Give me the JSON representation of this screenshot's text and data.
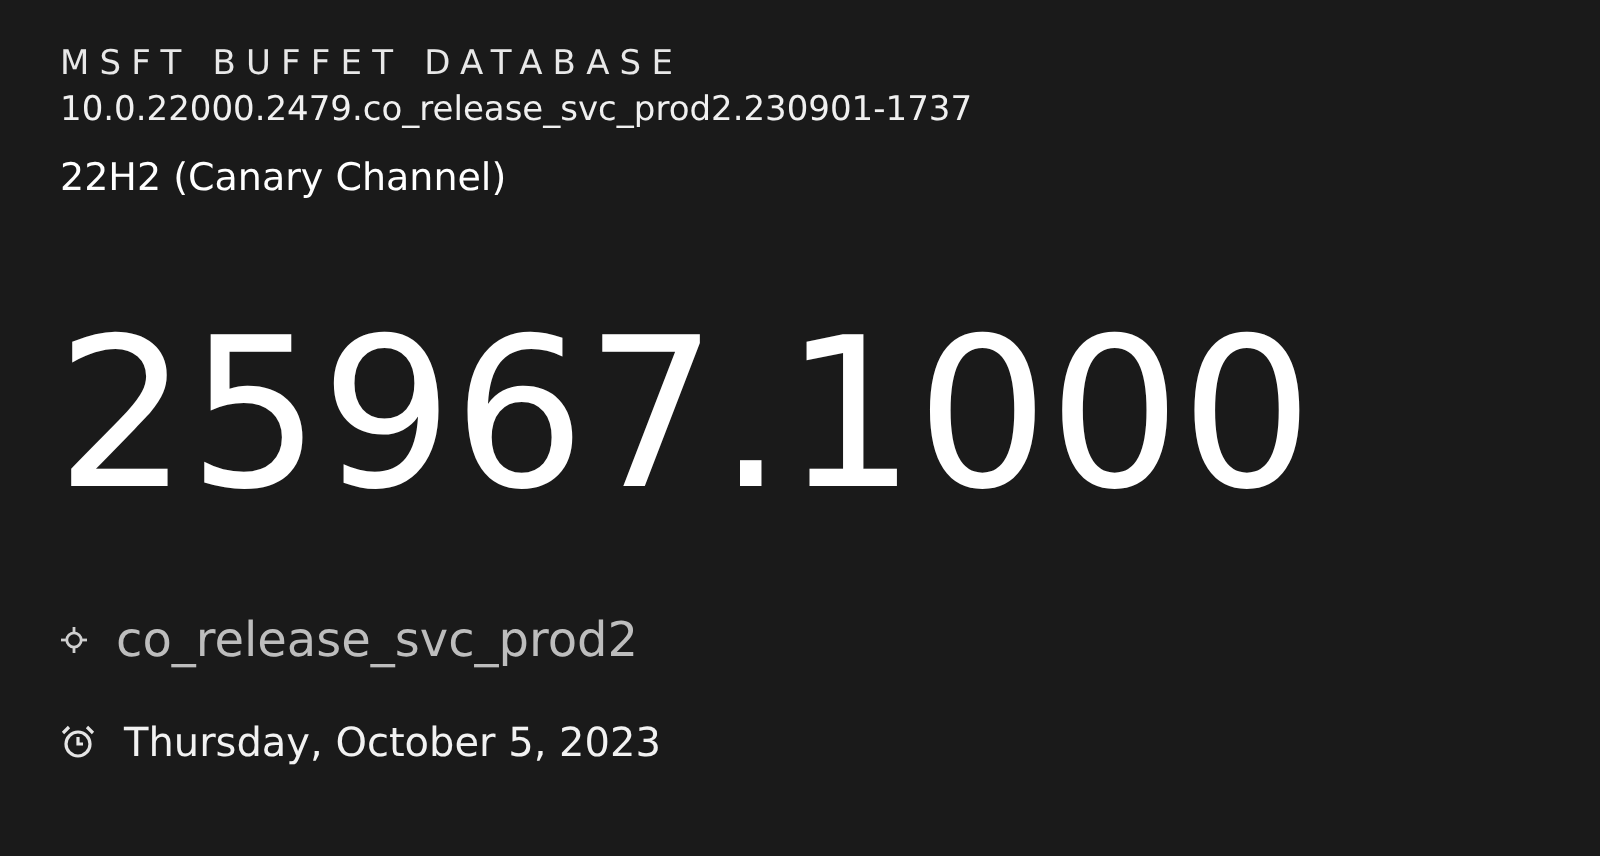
{
  "header": {
    "title": "MSFT BUFFET DATABASE",
    "build_string": "10.0.22000.2479.co_release_svc_prod2.230901-1737",
    "channel": "22H2 (Canary Channel)"
  },
  "build_number": "25967.1000",
  "details": [
    {
      "kind": "branch",
      "text": "co_release_svc_prod2"
    },
    {
      "kind": "date",
      "text": "Thursday, October 5, 2023"
    }
  ]
}
